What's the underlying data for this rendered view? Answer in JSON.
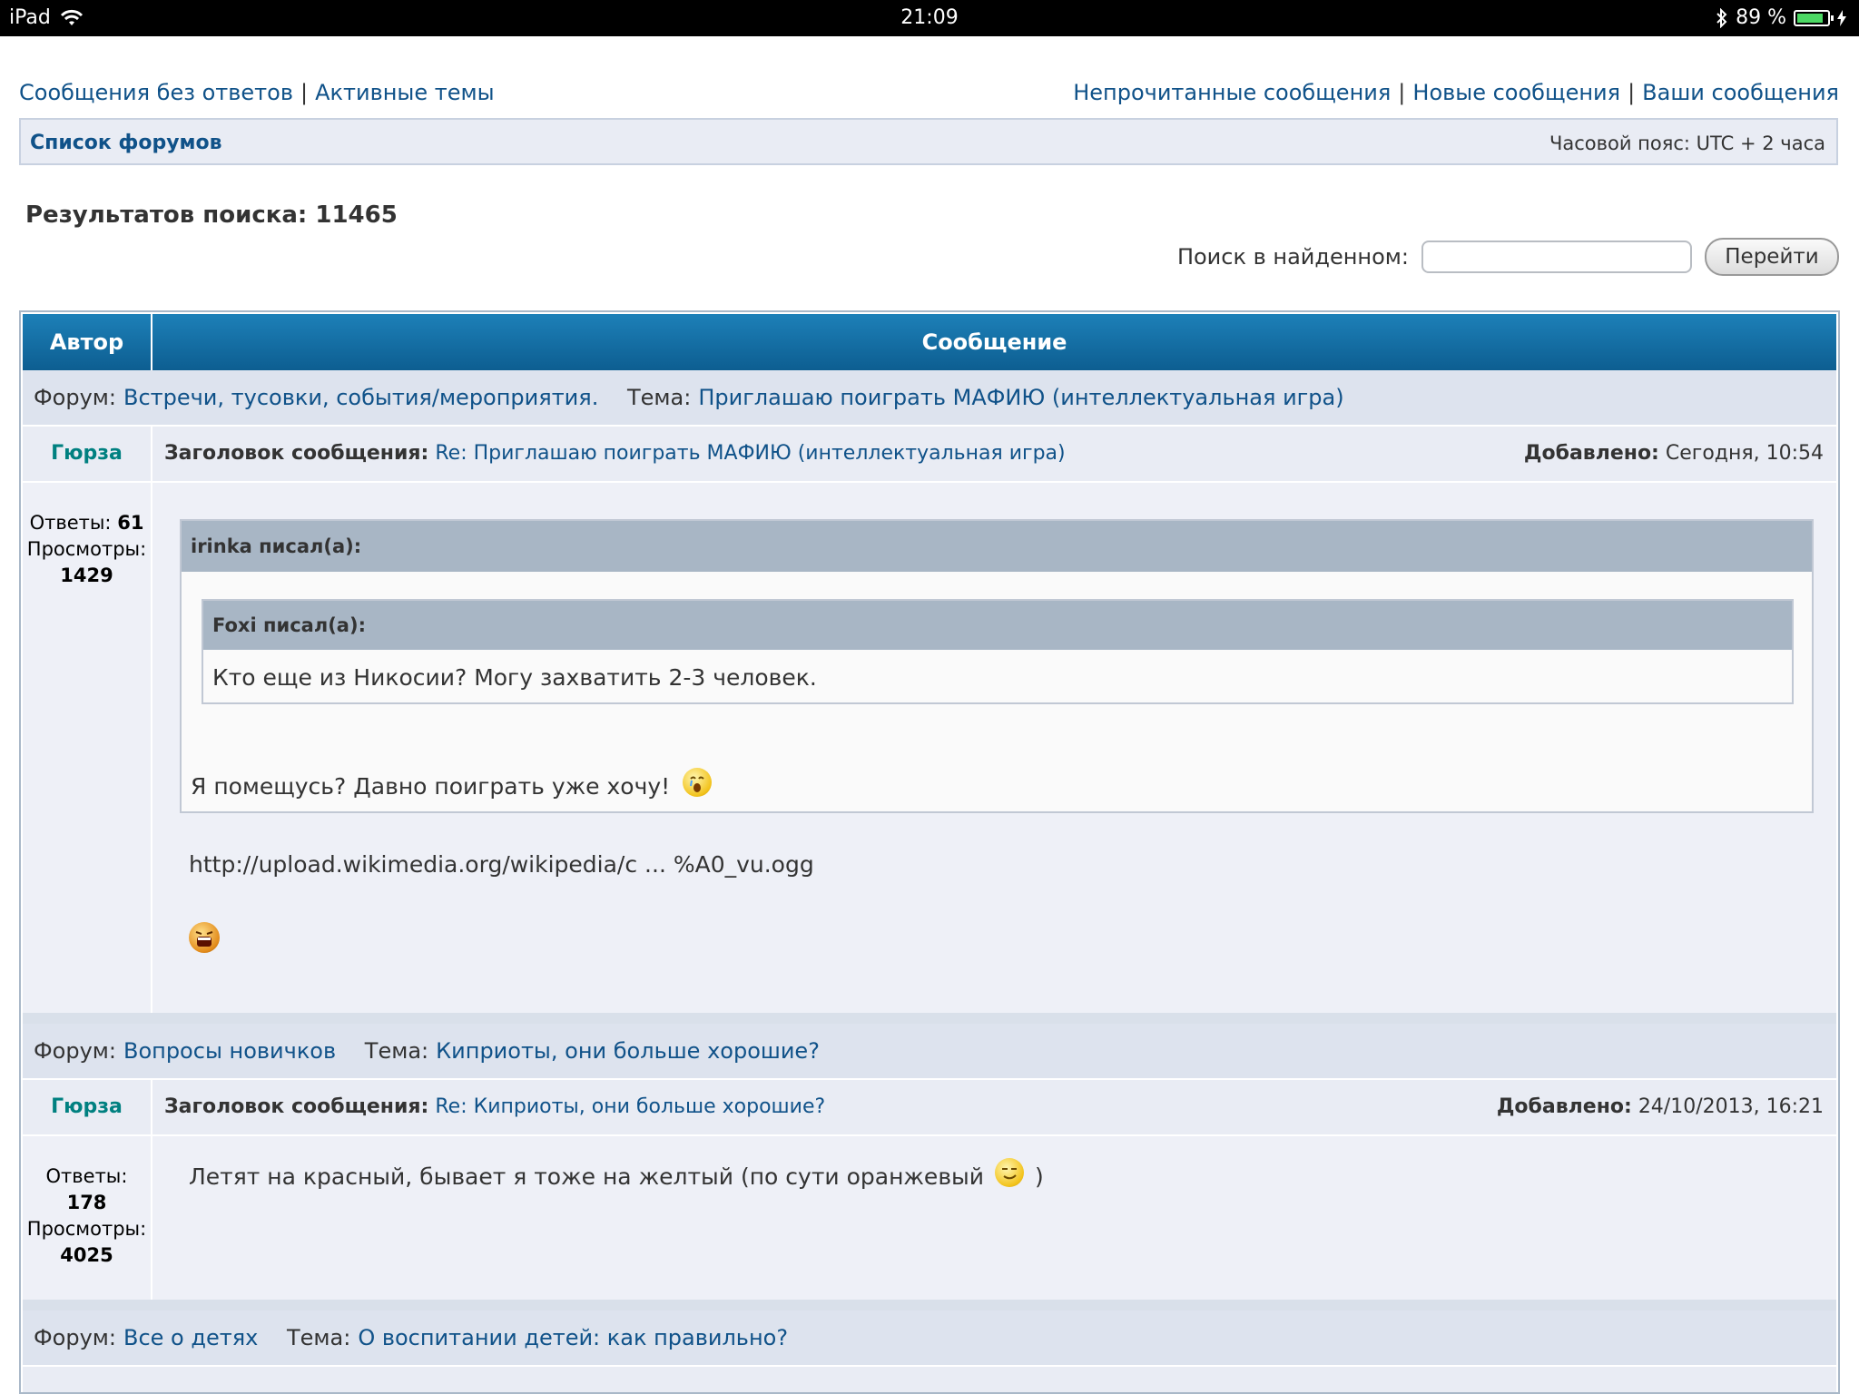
{
  "status_bar": {
    "device": "iPad",
    "time": "21:09",
    "battery": "89 %",
    "battery_level": 0.89
  },
  "top_nav": {
    "left_links": [
      "Сообщения без ответов",
      "Активные темы"
    ],
    "right_links": [
      "Непрочитанные сообщения",
      "Новые сообщения",
      "Ваши сообщения"
    ],
    "separator": "|"
  },
  "navbar": {
    "forums_link": "Список форумов",
    "timezone": "Часовой пояс: UTC + 2 часа"
  },
  "search": {
    "results_count": "Результатов поиска: 11465",
    "search_in_label": "Поиск в найденном:",
    "search_in_value": "",
    "go_button": "Перейти"
  },
  "table": {
    "col_author": "Автор",
    "col_message": "Сообщение",
    "forum_label": "Форум:",
    "topic_label": "Тема:",
    "subject_label": "Заголовок сообщения:",
    "added_label": "Добавлено:",
    "replies_label": "Ответы:",
    "views_label": "Просмотры:"
  },
  "posts": [
    {
      "forum": "Встречи, тусовки, события/мероприятия.",
      "topic": "Приглашаю поиграть МАФИЮ (интеллектуальная игра)",
      "author": "Гюрза",
      "subject": "Re: Приглашаю поиграть МАФИЮ (интеллектуальная игра)",
      "added": "Сегодня, 10:54",
      "replies": "61",
      "views": "1429",
      "quote_outer_author": "irinka писал(а):",
      "quote_inner_author": "Foxi писал(а):",
      "quote_inner_text": "Кто еще из Никосии? Могу захватить 2-3 человек.",
      "quote_outer_text": "Я помещусь? Давно поиграть уже хочу!",
      "link": "http://upload.wikimedia.org/wikipedia/c ... %A0_vu.ogg"
    },
    {
      "forum": "Вопросы новичков",
      "topic": "Киприоты, они больше хорошие?",
      "author": "Гюрза",
      "subject": "Re: Киприоты, они больше хорошие?",
      "added": "24/10/2013, 16:21",
      "replies": "178",
      "views": "4025",
      "text_before": "Летят на красный, бывает я тоже на желтый (по сути оранжевый",
      "text_after": ")"
    },
    {
      "forum": "Все о детях",
      "topic": "О воспитании детей: как правильно?"
    }
  ],
  "colors": {
    "link": "#105289",
    "author": "#008080",
    "header_gradient_top": "#1d80b8",
    "header_gradient_bottom": "#0d5e91"
  }
}
